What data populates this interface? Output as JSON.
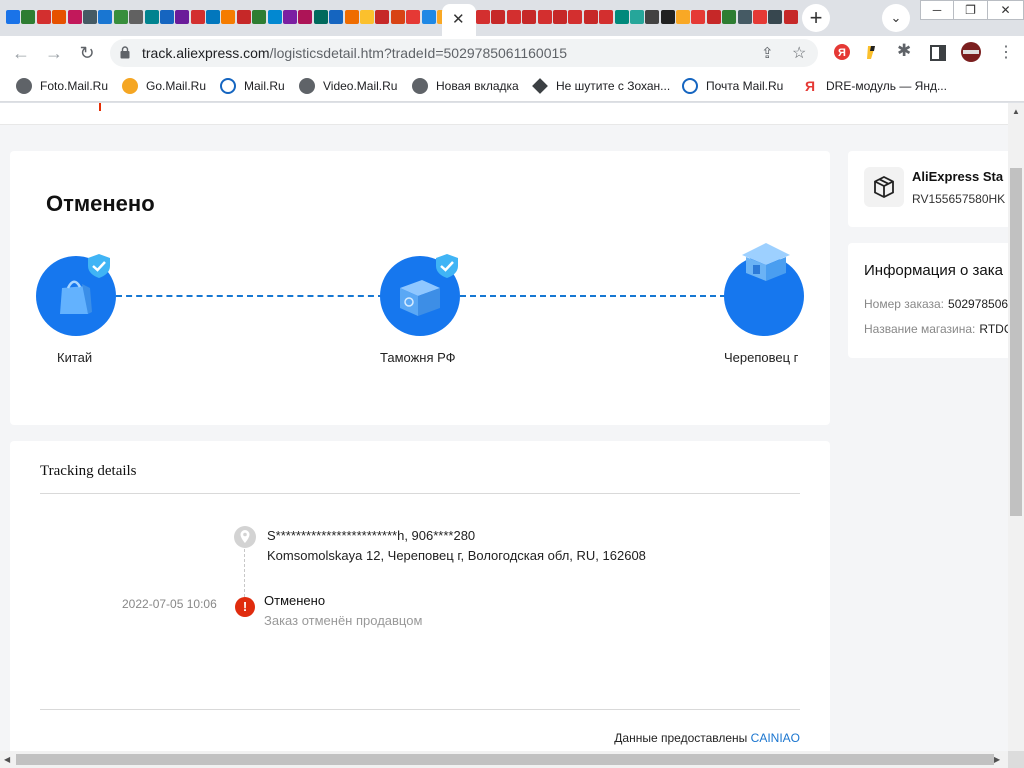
{
  "browser": {
    "url_host": "track.aliexpress.com",
    "url_path": "/logisticsdetail.htm?tradeId=5029785061160015",
    "tab_colors_left": [
      "#1a73e8",
      "#2e7d32",
      "#d32f2f",
      "#e65100",
      "#c2185b",
      "#455a64",
      "#1976d2",
      "#388e3c",
      "#616161",
      "#00838f",
      "#1565c0",
      "#6a1b9a",
      "#d32f2f",
      "#0277bd",
      "#f57c00",
      "#c62828",
      "#2e7d32",
      "#0288d1",
      "#7b1fa2",
      "#ad1457",
      "#00695c",
      "#1565c0",
      "#ef6c00",
      "#fbc02d",
      "#c62828",
      "#d84315",
      "#e53935",
      "#1e88e5",
      "#f9a825"
    ],
    "tab_colors_right": [
      "#d32f2f",
      "#c62828",
      "#d32f2f",
      "#c62828",
      "#d32f2f",
      "#c62828",
      "#d32f2f",
      "#c62828",
      "#d32f2f",
      "#00897b",
      "#26a69a",
      "#424242",
      "#212121",
      "#f9a825",
      "#e53935",
      "#c62828",
      "#2e7d32",
      "#455a64",
      "#e53935",
      "#37474f",
      "#c62828"
    ],
    "accent_color": "#1a73e8"
  },
  "bookmarks": [
    {
      "label": "Foto.Mail.Ru",
      "icon": "globe-icon",
      "color": "#5f6368"
    },
    {
      "label": "Go.Mail.Ru",
      "icon": "search-icon",
      "color": "#f5a623"
    },
    {
      "label": "Mail.Ru",
      "icon": "at-icon",
      "color": "#1565c0"
    },
    {
      "label": "Video.Mail.Ru",
      "icon": "globe-icon",
      "color": "#5f6368"
    },
    {
      "label": "Новая вкладка",
      "icon": "globe-icon",
      "color": "#5f6368"
    },
    {
      "label": "Не шутите с Зохан...",
      "icon": "diamond-icon",
      "color": "#3c4043"
    },
    {
      "label": "Почта Mail.Ru",
      "icon": "at-icon",
      "color": "#1565c0"
    },
    {
      "label": "DRE-модуль — Янд...",
      "icon": "yandex-icon",
      "color": "#e53935"
    }
  ],
  "status": {
    "title": "Отменено",
    "stages": [
      {
        "label": "Китай",
        "icon": "bag-icon",
        "checked": true
      },
      {
        "label": "Таможня РФ",
        "icon": "customs-box-icon",
        "checked": true
      },
      {
        "label": "Череповец г",
        "icon": "house-icon",
        "checked": false
      }
    ],
    "stage_color": "#1677ee",
    "check_color": "#40b4f5"
  },
  "tracking": {
    "title": "Tracking details",
    "address_name": "S************************h,  906****280",
    "address_line": "Komsomolskaya 12,  Череповец г,  Вологодская обл,  RU,  162608",
    "event": {
      "time": "2022-07-05 10:06",
      "status": "Отменено",
      "description": "Заказ отменён продавцом",
      "alert_color": "#e02c0e"
    },
    "provided_by": "Данные предоставлены",
    "provider": "CAINIAO"
  },
  "package": {
    "name": "AliExpress Sta",
    "number": "RV155657580HK"
  },
  "order_info": {
    "title": "Информация о зака",
    "rows": [
      {
        "label": "Номер заказа:",
        "value": "502978506"
      },
      {
        "label": "Название магазина:",
        "value": "RTDC"
      }
    ]
  }
}
